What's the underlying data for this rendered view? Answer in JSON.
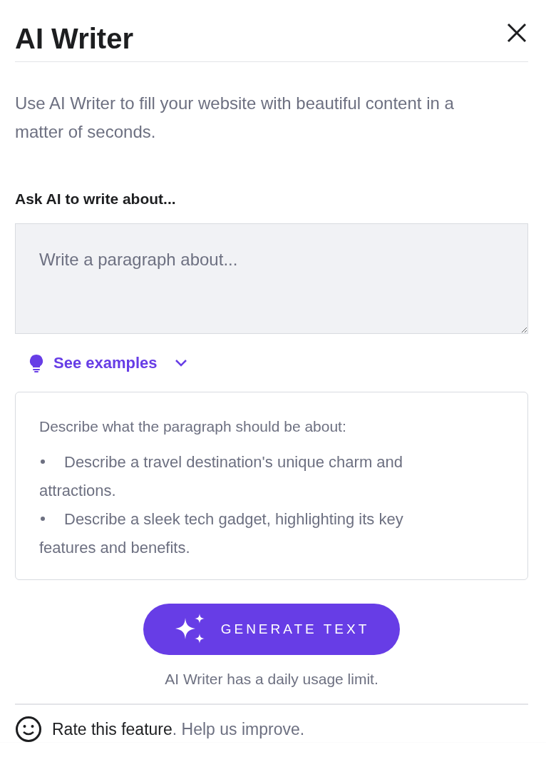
{
  "panel": {
    "title": "AI Writer",
    "description": "Use AI Writer to fill your website with beautiful content in a matter of seconds."
  },
  "prompt": {
    "label": "Ask AI to write about...",
    "placeholder": "Write a paragraph about..."
  },
  "examples": {
    "toggle": "See examples",
    "expanded": true,
    "intro": "Describe what the paragraph should be about:",
    "items": [
      "Describe a travel destination's unique charm and attractions.",
      "Describe a sleek tech gadget, highlighting its key features and benefits."
    ]
  },
  "generate_button": "GENERATE TEXT",
  "usage_note": "AI Writer has a daily usage limit.",
  "feedback": {
    "link": "Rate this feature",
    "text": ". Help us improve."
  }
}
